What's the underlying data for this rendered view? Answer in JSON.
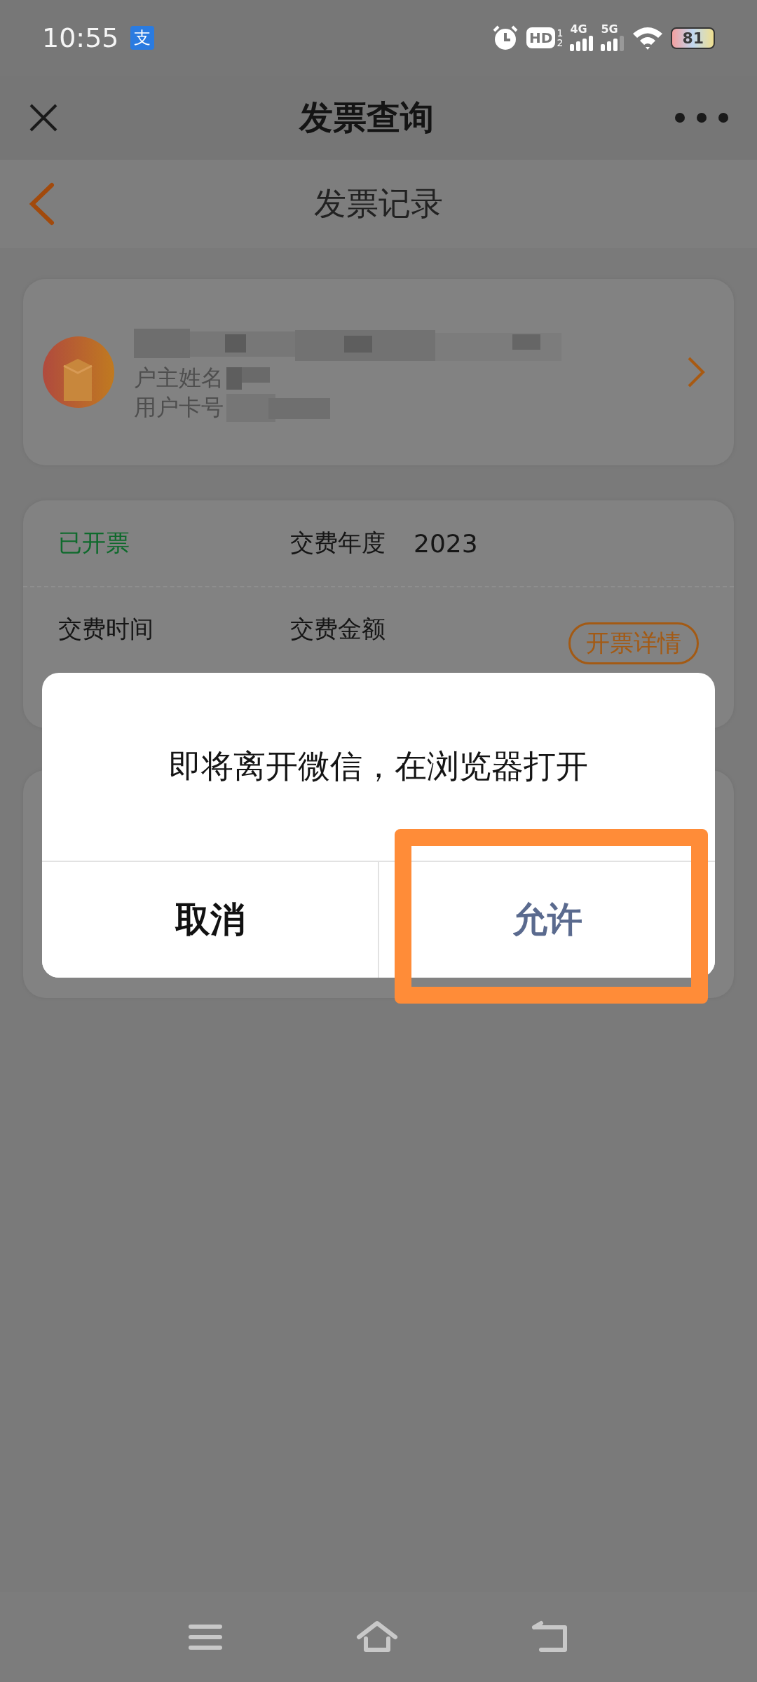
{
  "status_bar": {
    "time": "10:55",
    "app_badge": "支",
    "hd_label": "HD",
    "hd_sup": "1",
    "hd_sub": "2",
    "network_1": "4G",
    "network_2": "5G",
    "battery": "81"
  },
  "nav_bar": {
    "title": "发票查询"
  },
  "page_header": {
    "title": "发票记录"
  },
  "account_card": {
    "owner_label": "户主姓名",
    "card_label": "用户卡号"
  },
  "invoice_card": {
    "status": "已开票",
    "year_label": "交费年度",
    "year": "2023",
    "time_label": "交费时间",
    "amount_label": "交费金额",
    "detail_button": "开票详情"
  },
  "dialog": {
    "message": "即将离开微信，在浏览器打开",
    "buttons": [
      {
        "label": "取消",
        "kind": "cancel",
        "highlighted": false
      },
      {
        "label": "允许",
        "kind": "confirm",
        "highlighted": true
      }
    ]
  }
}
